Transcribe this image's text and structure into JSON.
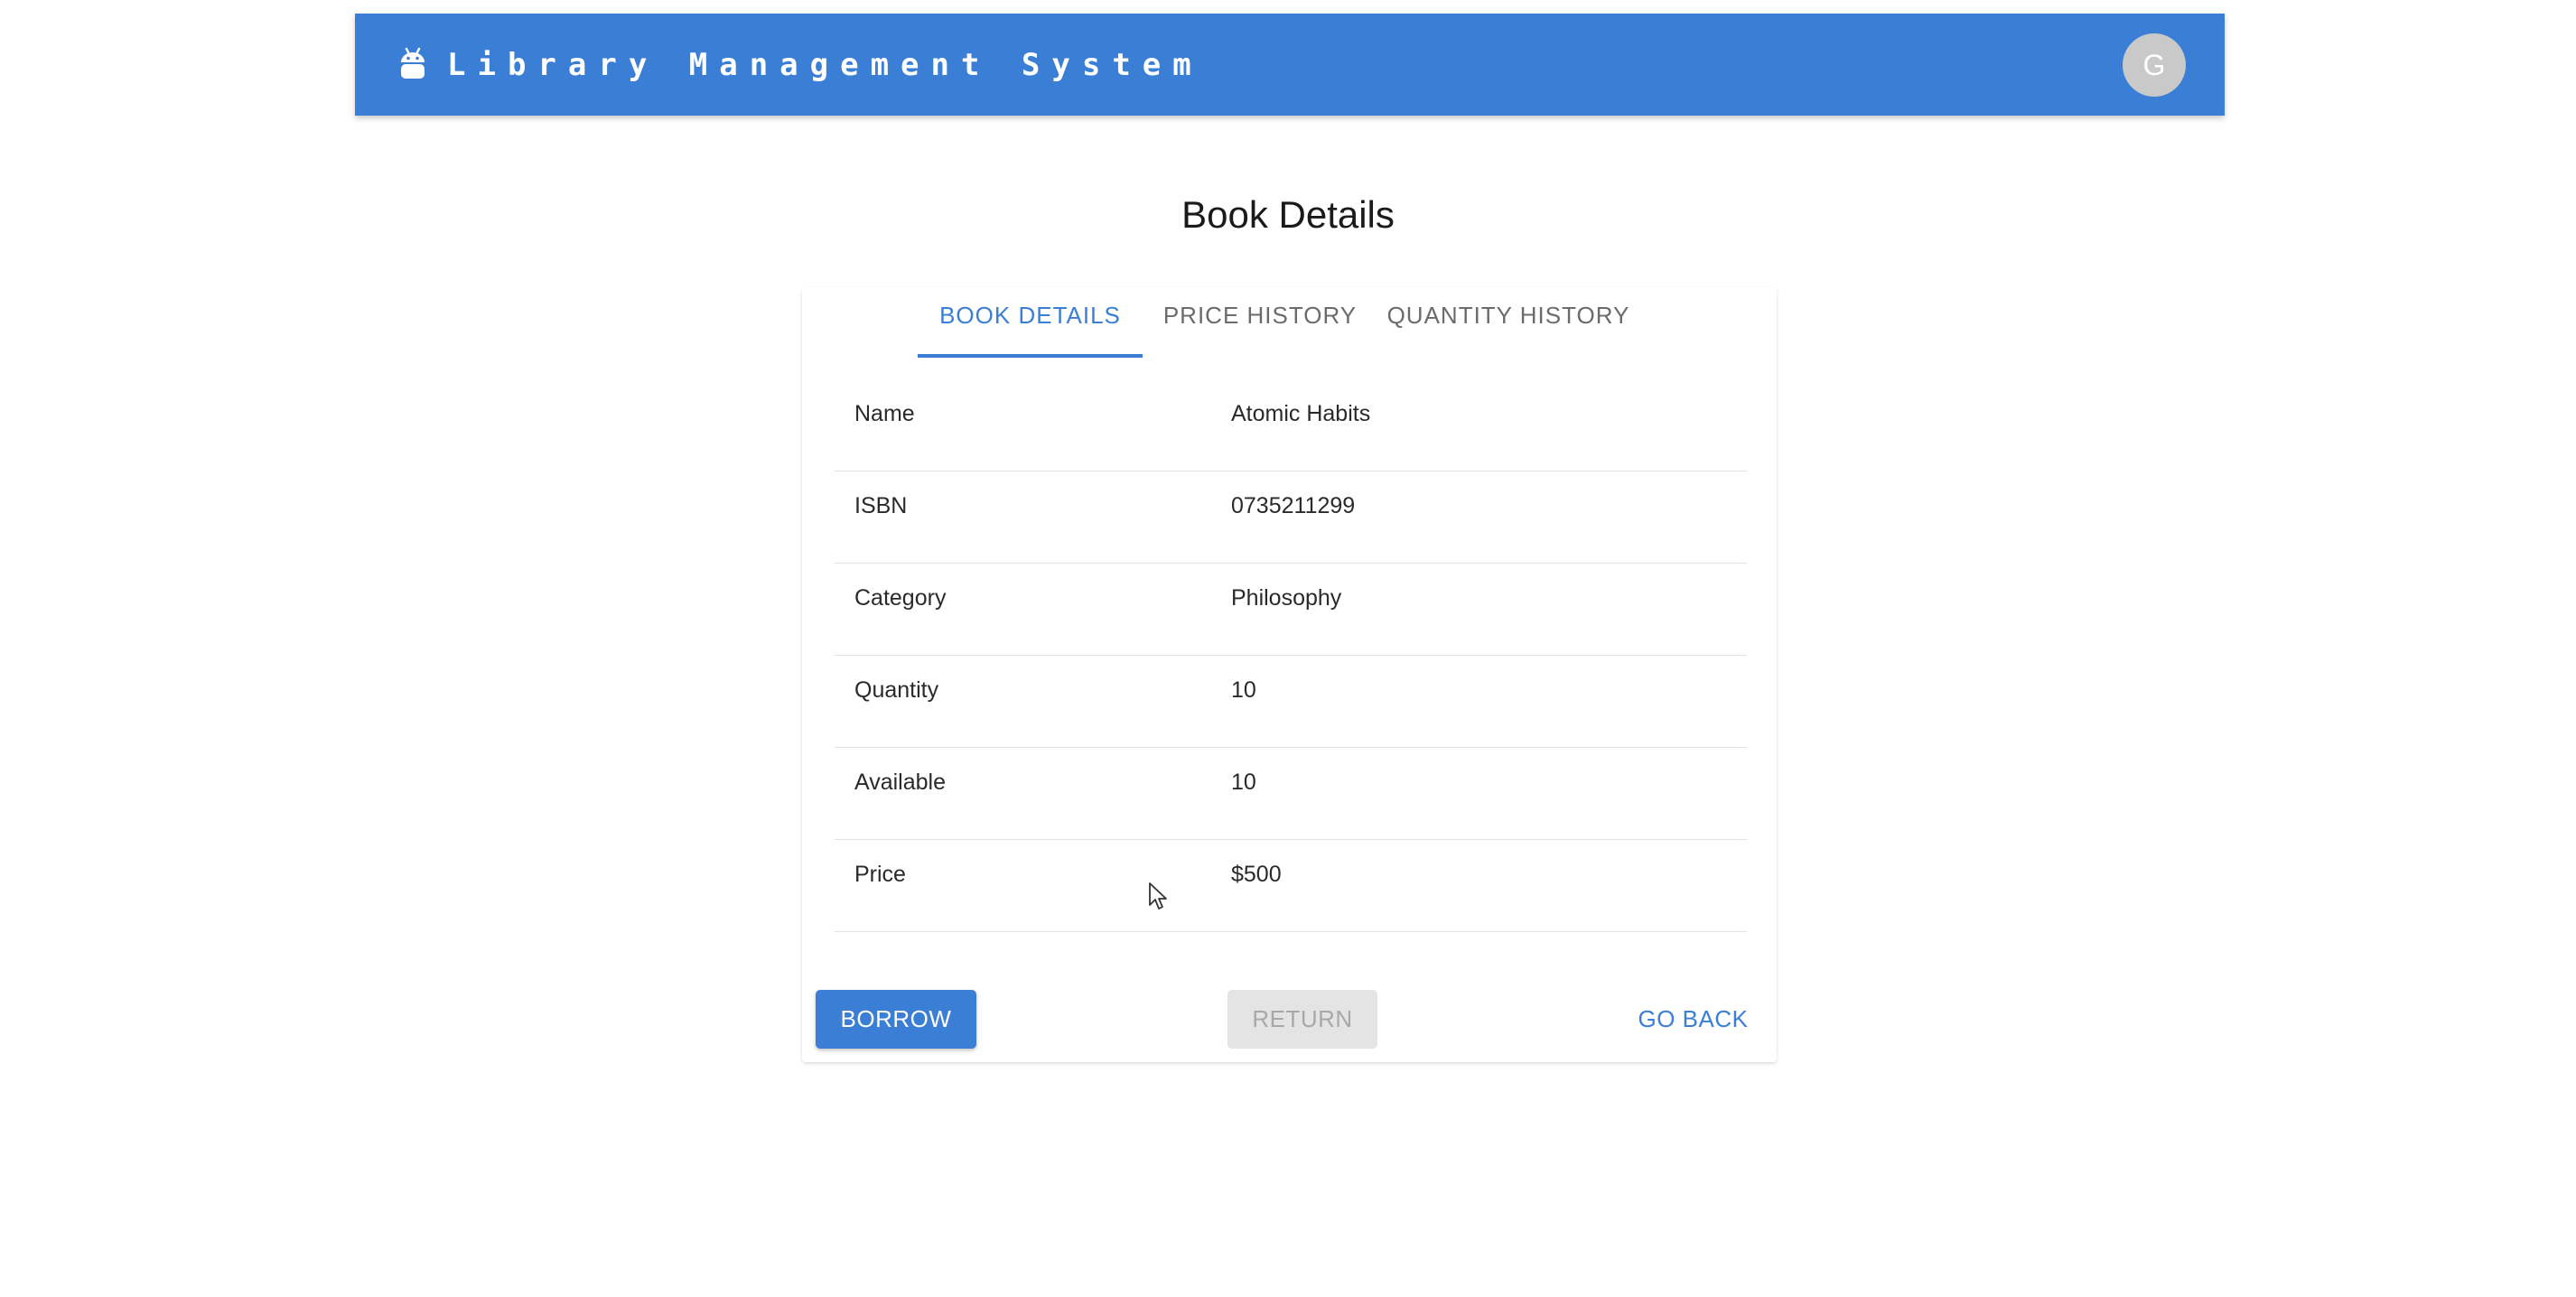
{
  "header": {
    "title": "Library Management System",
    "logo_icon": "android-icon",
    "avatar_initial": "G",
    "bar_color": "#3a7fd5"
  },
  "page": {
    "title": "Book Details"
  },
  "tabs": [
    {
      "label": "BOOK DETAILS",
      "active": true
    },
    {
      "label": "PRICE HISTORY",
      "active": false
    },
    {
      "label": "QUANTITY HISTORY",
      "active": false
    }
  ],
  "details": [
    {
      "label": "Name",
      "value": "Atomic Habits"
    },
    {
      "label": "ISBN",
      "value": "0735211299"
    },
    {
      "label": "Category",
      "value": "Philosophy"
    },
    {
      "label": "Quantity",
      "value": "10"
    },
    {
      "label": "Available",
      "value": "10"
    },
    {
      "label": "Price",
      "value": "$500"
    }
  ],
  "actions": {
    "borrow_label": "BORROW",
    "return_label": "RETURN",
    "return_disabled": true,
    "go_back_label": "GO BACK"
  }
}
